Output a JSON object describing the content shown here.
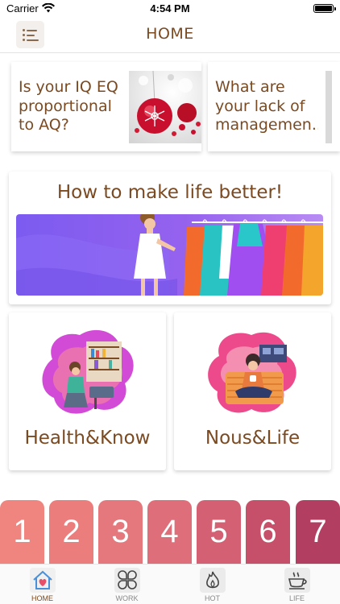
{
  "status_bar": {
    "carrier": "Carrier",
    "time": "4:54 PM"
  },
  "nav": {
    "title": "HOME",
    "menu_icon": "list-menu-icon"
  },
  "articles": [
    {
      "title": "Is your IQ EQ proportional to AQ?",
      "lines": [
        "Is your IQ EQ",
        "proportional",
        "to AQ?"
      ]
    },
    {
      "title": "What are your lack of managemen...",
      "lines": [
        "What are",
        "your lack of",
        "managemen..."
      ]
    }
  ],
  "feature": {
    "title": "How to make life better!"
  },
  "categories": [
    {
      "label": "Health&Know"
    },
    {
      "label": "Nous&Life"
    }
  ],
  "number_tabs": [
    {
      "label": "1",
      "color": "#f0857f"
    },
    {
      "label": "2",
      "color": "#eb7d7d"
    },
    {
      "label": "3",
      "color": "#e5787c"
    },
    {
      "label": "4",
      "color": "#de6e79"
    },
    {
      "label": "5",
      "color": "#d46173"
    },
    {
      "label": "6",
      "color": "#c64f69"
    },
    {
      "label": "7",
      "color": "#b23f62"
    }
  ],
  "tab_bar": [
    {
      "label": "HOME",
      "icon": "home-heart-icon",
      "active": true
    },
    {
      "label": "WORK",
      "icon": "grid-flower-icon",
      "active": false
    },
    {
      "label": "HOT",
      "icon": "flame-icon",
      "active": false
    },
    {
      "label": "LIFE",
      "icon": "coffee-cup-icon",
      "active": false
    }
  ],
  "colors": {
    "accent": "#7a4a22",
    "banner": "#8a5ff0"
  }
}
